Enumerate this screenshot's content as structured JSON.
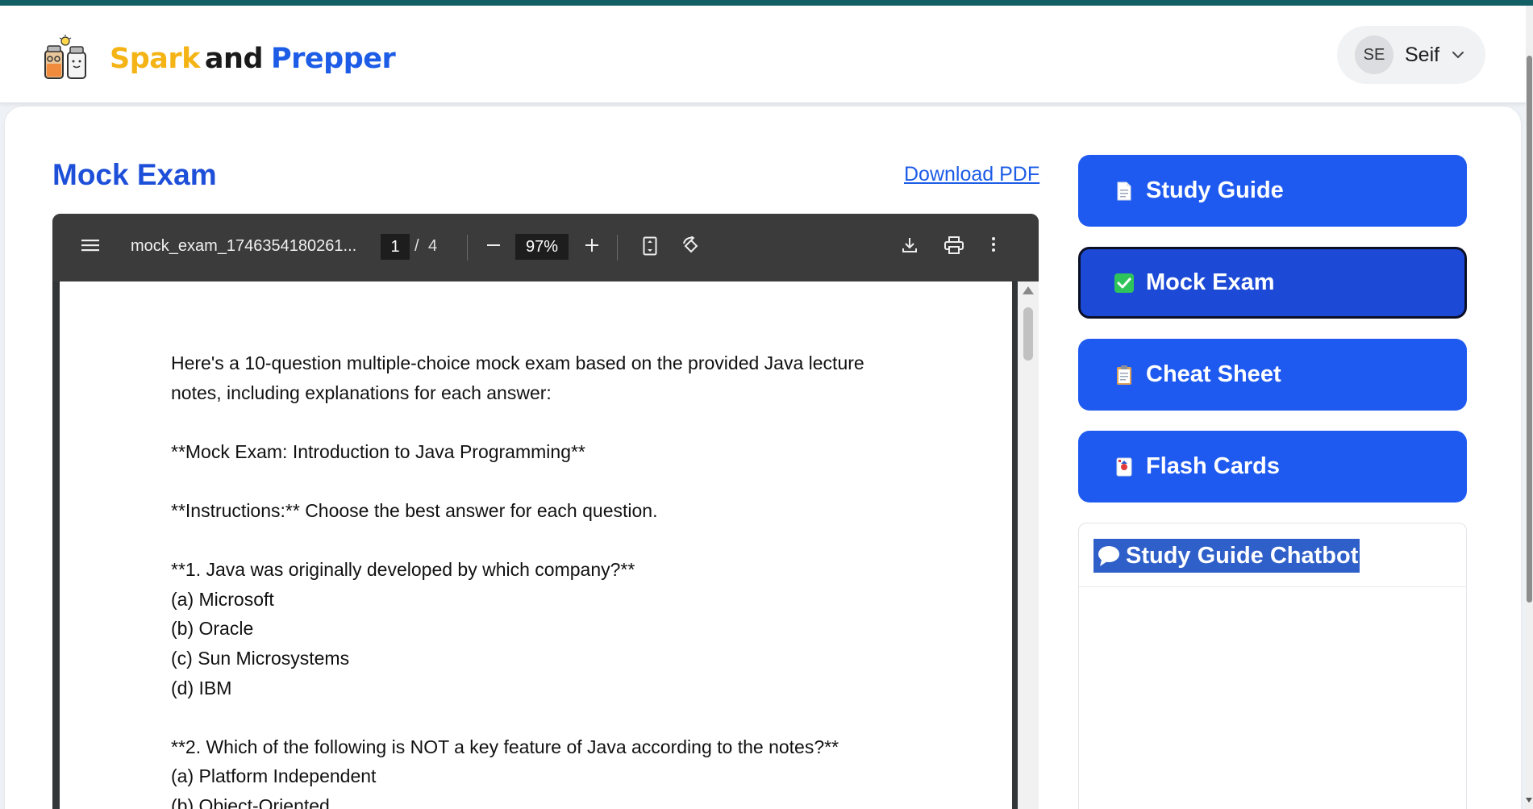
{
  "brand": {
    "part1": "Spark",
    "part2": "and",
    "part3": "Prepper"
  },
  "user": {
    "initials": "SE",
    "name": "Seif"
  },
  "page": {
    "title": "Mock Exam",
    "download_label": "Download PDF"
  },
  "pdf_viewer": {
    "filename": "mock_exam_1746354180261...",
    "current_page": "1",
    "separator": "/",
    "total_pages": "4",
    "zoom": "97%",
    "lines": [
      "Here's a 10-question multiple-choice mock exam based on the provided Java lecture",
      "notes, including explanations for each answer:",
      "",
      "**Mock Exam: Introduction to Java Programming**",
      "",
      "**Instructions:** Choose the best answer for each question.",
      "",
      "**1. Java was originally developed by which company?**",
      "(a) Microsoft",
      "(b) Oracle",
      "(c) Sun Microsystems",
      "(d) IBM",
      "",
      "**2. Which of the following is NOT a key feature of Java according to the notes?**",
      "(a) Platform Independent",
      "(b) Object-Oriented"
    ]
  },
  "sidebar": {
    "items": [
      {
        "label": "Study Guide",
        "icon": "document-icon",
        "active": false
      },
      {
        "label": "Mock Exam",
        "icon": "check-icon",
        "active": true
      },
      {
        "label": "Cheat Sheet",
        "icon": "clipboard-icon",
        "active": false
      },
      {
        "label": "Flash Cards",
        "icon": "playing-card-icon",
        "active": false
      }
    ]
  },
  "chatbot": {
    "title": "Study Guide Chatbot",
    "icon": "speech-bubble-icon"
  },
  "colors": {
    "accent": "#1f5af0",
    "title_blue": "#1d4fd8",
    "brand_yellow": "#f4b416",
    "top_strip": "#135f66"
  }
}
